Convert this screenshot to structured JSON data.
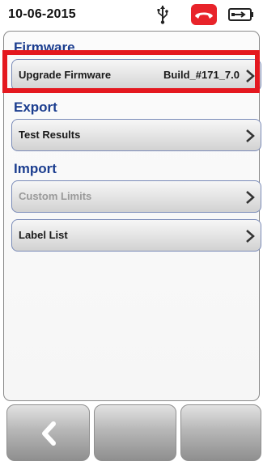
{
  "status_bar": {
    "date": "10-06-2015"
  },
  "sections": {
    "firmware": {
      "title": "Firmware",
      "rows": [
        {
          "label": "Upgrade Firmware",
          "value": "Build_#171_7.0"
        }
      ]
    },
    "export": {
      "title": "Export",
      "rows": [
        {
          "label": "Test Results"
        }
      ]
    },
    "import": {
      "title": "Import",
      "rows": [
        {
          "label": "Custom Limits",
          "disabled": true
        },
        {
          "label": "Label List"
        }
      ]
    }
  },
  "icons": [
    "usb-icon",
    "phone-hangup-icon",
    "battery-icon",
    "chevron-right-icon",
    "back-arrow-icon"
  ],
  "colors": {
    "accent": "#1b3d8f",
    "highlight": "#e4181f",
    "phone": "#e8232a"
  }
}
